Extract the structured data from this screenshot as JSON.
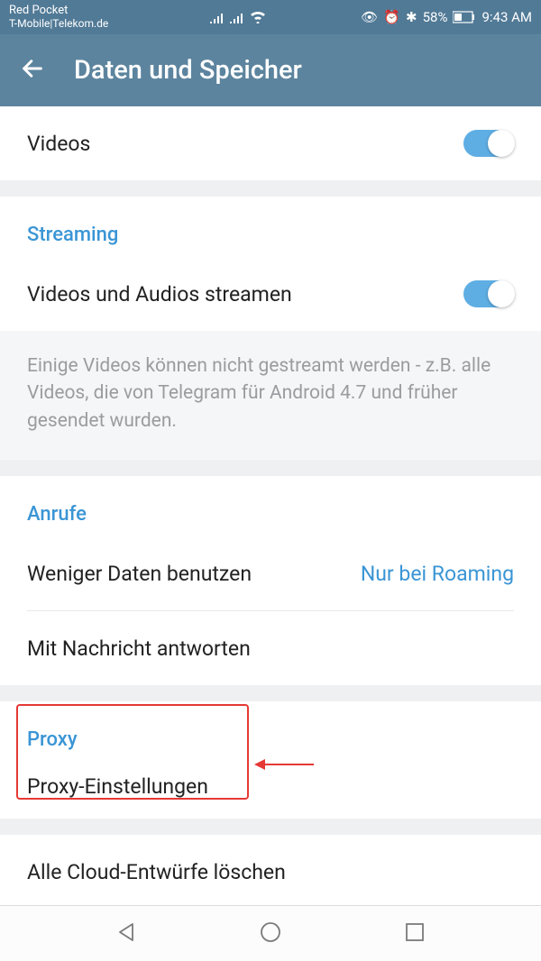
{
  "status": {
    "carrier1": "Red Pocket",
    "carrier2": "T-Mobile|Telekom.de",
    "battery_pct": "58%",
    "time": "9:43 AM"
  },
  "header": {
    "title": "Daten und Speicher"
  },
  "rows": {
    "videos": "Videos",
    "streaming_header": "Streaming",
    "streaming_row": "Videos und Audios streamen",
    "streaming_info": "Einige Videos können nicht gestreamt werden - z.B. alle Videos, die von Telegram für Android 4.7 und früher gesendet wurden.",
    "calls_header": "Anrufe",
    "less_data": "Weniger Daten benutzen",
    "less_data_value": "Nur bei Roaming",
    "reply_with_msg": "Mit Nachricht antworten",
    "proxy_header": "Proxy",
    "proxy_settings": "Proxy-Einstellungen",
    "delete_drafts": "Alle Cloud-Entwürfe löschen"
  }
}
